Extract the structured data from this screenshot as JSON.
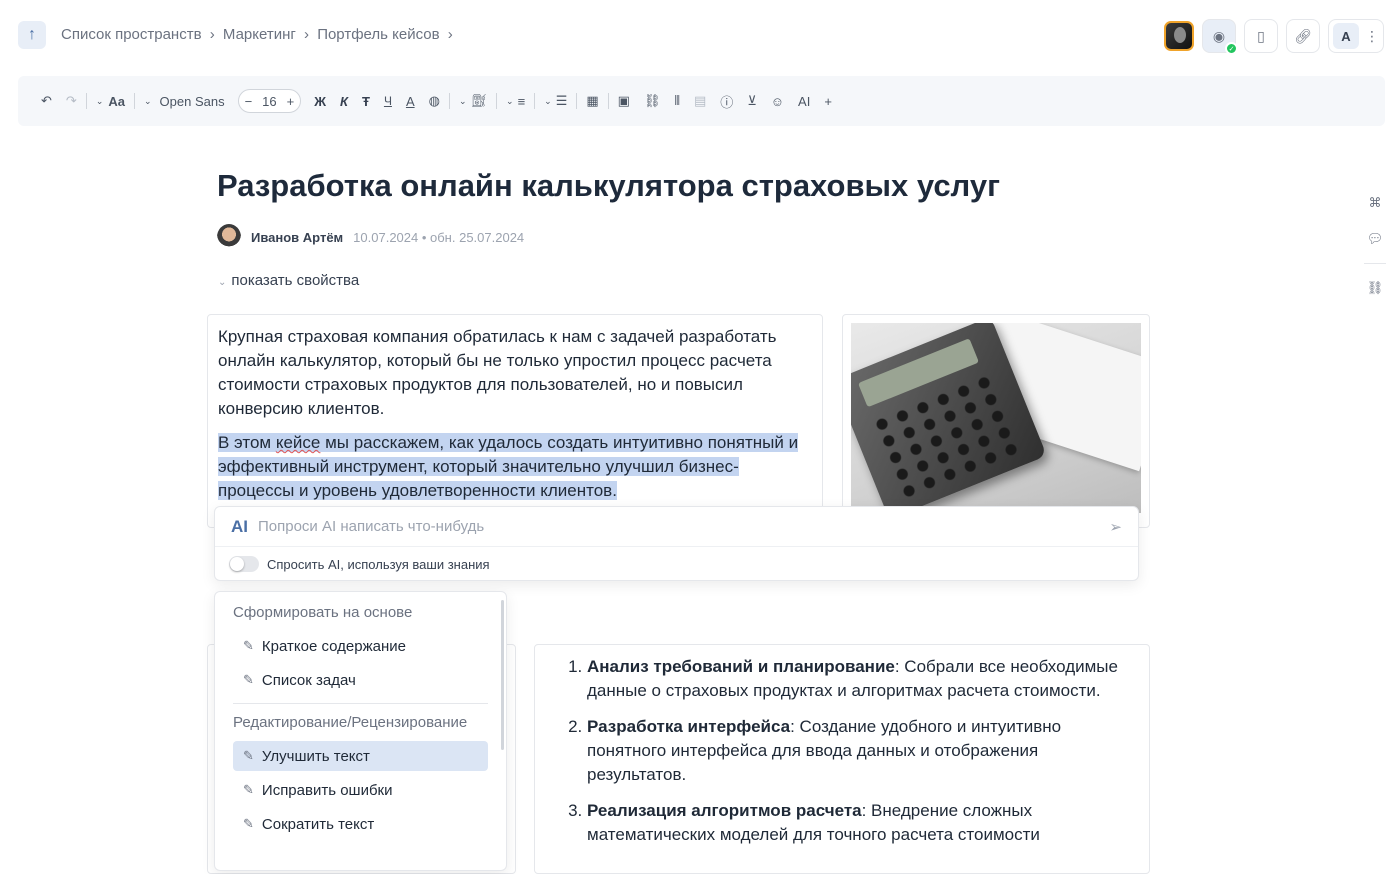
{
  "topbar": {
    "breadcrumb": [
      "Список пространств",
      "›",
      "Маркетинг",
      "›",
      "Портфель кейсов",
      "›"
    ],
    "user_initial": "A"
  },
  "toolbar": {
    "font_name": "Open Sans",
    "font_size": "16",
    "bold": "Ж",
    "italic": "К",
    "strike": "Ŧ",
    "underline": "Ч",
    "ai": "AI",
    "plus": "+"
  },
  "document": {
    "title": "Разработка онлайн калькулятора страховых услуг",
    "author": "Иванов Артём",
    "meta": "10.07.2024 • обн. 25.07.2024",
    "show_props": "показать свойства",
    "para1": "Крупная страховая компания обратилась к нам с задачей разработать онлайн калькулятор, который бы не только упростил процесс расчета стоимости страховых продуктов для пользователей, но и повысил конверсию клиентов.",
    "para2_pre": "В этом ",
    "para2_word": "кейсе",
    "para2_post": " мы расскажем, как удалось создать интуитивно понятный и эффективный инструмент, который значительно улучшил бизнес-процессы и уровень удовлетворенности клиентов.",
    "steps": [
      {
        "title": "Анализ требований и планирование",
        "text": ": Собрали все необходимые данные о страховых продуктах и алгоритмах расчета стоимости."
      },
      {
        "title": "Разработка интерфейса",
        "text": ": Создание удобного и интуитивно понятного интерфейса для ввода данных и отображения результатов."
      },
      {
        "title": "Реализация алгоритмов расчета",
        "text": ": Внедрение сложных математических моделей для точного расчета стоимости"
      }
    ]
  },
  "ai_panel": {
    "logo": "AI",
    "placeholder": "Попроси AI написать что-нибудь",
    "toggle_label": "Спросить AI, используя ваши знания"
  },
  "menu": {
    "section1": "Сформировать на основе",
    "items1": [
      "Краткое содержание",
      "Список задач"
    ],
    "section2": "Редактирование/Рецензирование",
    "items2": [
      "Улучшить текст",
      "Исправить ошибки",
      "Сократить текст"
    ]
  },
  "colors": {
    "accent": "#4a6fa5",
    "selection": "#c3d4f0",
    "active_item": "#dbe5f4",
    "success": "#22c55e"
  }
}
